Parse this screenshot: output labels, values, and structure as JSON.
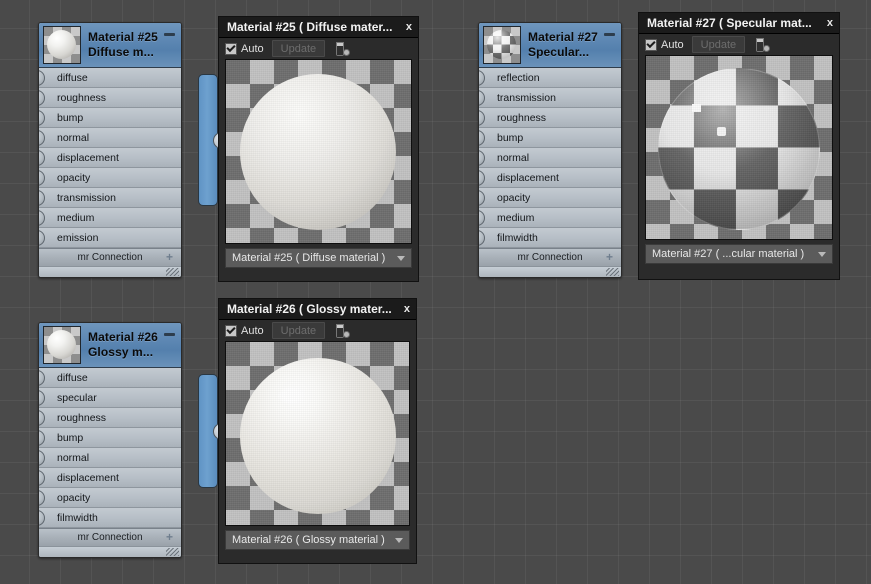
{
  "app": {
    "background_color": "#4a4a4a",
    "grid_color": "#565656",
    "node_header_color": "#5d87b3",
    "node_body_color": "#b4bcc4",
    "window_title_bar_color": "#1b1b1b"
  },
  "nodes": [
    {
      "id": "node-material-25",
      "title_line1": "Material #25",
      "title_line2": "Diffuse  m...",
      "minimize_label": "—",
      "thumbnail": "material-preview-sphere",
      "sockets": [
        "diffuse",
        "roughness",
        "bump",
        "normal",
        "displacement",
        "opacity",
        "transmission",
        "medium",
        "emission"
      ],
      "footer_label": "mr Connection",
      "footer_plus": "+"
    },
    {
      "id": "node-material-27",
      "title_line1": "Material #27",
      "title_line2": "Specular...",
      "minimize_label": "—",
      "thumbnail": "material-preview-sphere-specular",
      "sockets": [
        "reflection",
        "transmission",
        "roughness",
        "bump",
        "normal",
        "displacement",
        "opacity",
        "medium",
        "filmwidth"
      ],
      "footer_label": "mr Connection",
      "footer_plus": "+"
    },
    {
      "id": "node-material-26",
      "title_line1": "Material #26",
      "title_line2": "Glossy  m...",
      "minimize_label": "—",
      "thumbnail": "material-preview-sphere-glossy",
      "sockets": [
        "diffuse",
        "specular",
        "roughness",
        "bump",
        "normal",
        "displacement",
        "opacity",
        "filmwidth"
      ],
      "footer_label": "mr Connection",
      "footer_plus": "+"
    }
  ],
  "preview_windows": [
    {
      "id": "preview-material-25",
      "title": "Material #25  ( Diffuse mater...",
      "close_label": "x",
      "auto_label": "Auto",
      "auto_checked": true,
      "update_label": "Update",
      "update_enabled": false,
      "tube_icon": "test-tube-icon",
      "combo_value": "Material #25  ( Diffuse material )"
    },
    {
      "id": "preview-material-27",
      "title": "Material #27  ( Specular mat...",
      "close_label": "x",
      "auto_label": "Auto",
      "auto_checked": true,
      "update_label": "Update",
      "update_enabled": false,
      "tube_icon": "test-tube-icon",
      "combo_value": "Material #27  ( ...cular material )"
    },
    {
      "id": "preview-material-26",
      "title": "Material #26  ( Glossy mater...",
      "close_label": "x",
      "auto_label": "Auto",
      "auto_checked": true,
      "update_label": "Update",
      "update_enabled": false,
      "tube_icon": "test-tube-icon",
      "combo_value": "Material #26  ( Glossy material )"
    }
  ]
}
